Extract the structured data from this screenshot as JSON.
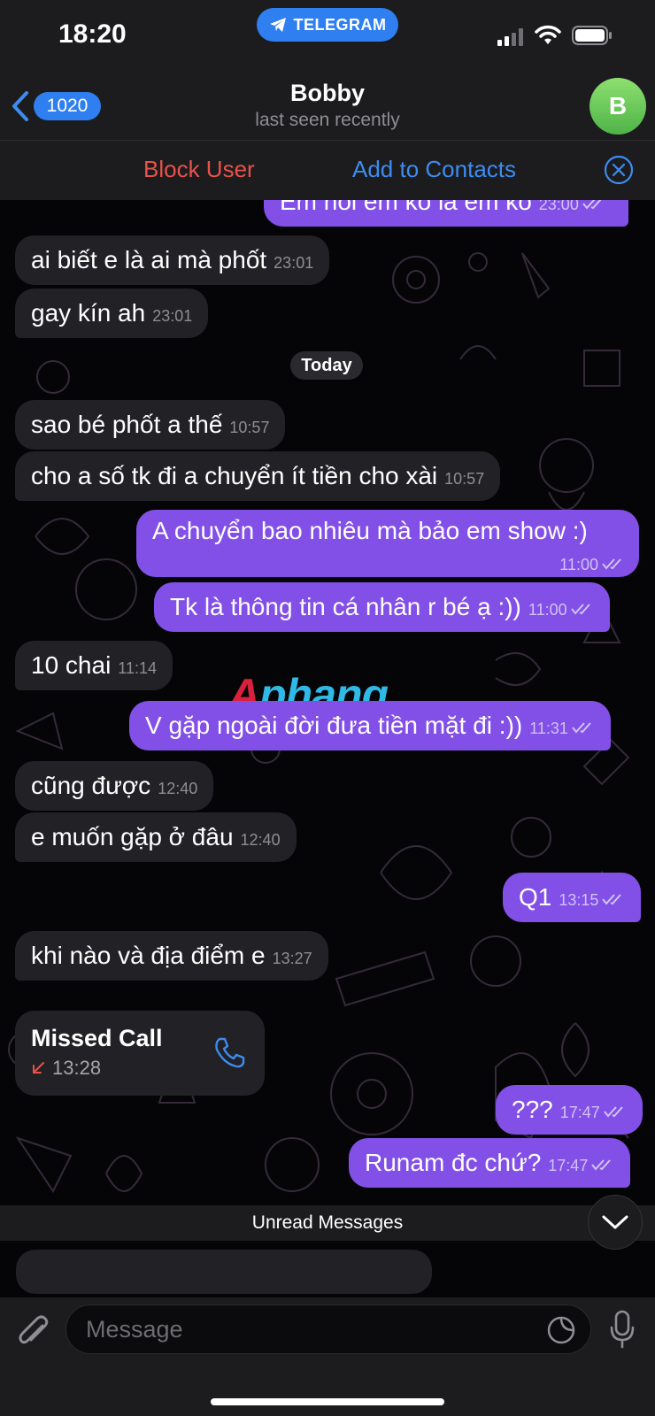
{
  "status_bar": {
    "time": "18:20",
    "app_pill": "TELEGRAM"
  },
  "header": {
    "back_count": "1020",
    "name": "Bobby",
    "status": "last seen recently",
    "avatar_letter": "B"
  },
  "actions": {
    "block": "Block User",
    "add": "Add to Contacts"
  },
  "messages": [
    {
      "dir": "out",
      "text": "Em hỏi em ko là em ko",
      "time": "23:00",
      "read": true
    },
    {
      "dir": "in",
      "text": "ai biết e là ai mà phốt",
      "time": "23:01"
    },
    {
      "dir": "in",
      "text": "gay kín ah",
      "time": "23:01"
    },
    {
      "dir": "in",
      "text": "sao bé phốt a thế",
      "time": "10:57"
    },
    {
      "dir": "in",
      "text": "cho a số tk đi a chuyển ít tiền cho xài",
      "time": "10:57"
    },
    {
      "dir": "out",
      "text": "A chuyển bao nhiêu mà bảo em show :)",
      "time": "11:00",
      "read": true
    },
    {
      "dir": "out",
      "text": "Tk là thông tin cá nhân r bé ạ :))",
      "time": "11:00",
      "read": true
    },
    {
      "dir": "in",
      "text": "10 chai",
      "time": "11:14"
    },
    {
      "dir": "out",
      "text": "V gặp ngoài đời đưa tiền mặt đi :))",
      "time": "11:31",
      "read": true
    },
    {
      "dir": "in",
      "text": "cũng được",
      "time": "12:40"
    },
    {
      "dir": "in",
      "text": "e muốn gặp ở đâu",
      "time": "12:40"
    },
    {
      "dir": "out",
      "text": "Q1",
      "time": "13:15",
      "read": true
    },
    {
      "dir": "in",
      "text": "khi nào và địa điểm e",
      "time": "13:27"
    },
    {
      "dir": "out",
      "text": "???",
      "time": "17:47",
      "read": true
    },
    {
      "dir": "out",
      "text": "Runam đc chứ?",
      "time": "17:47",
      "read": true
    }
  ],
  "date_divider": "Today",
  "missed_call": {
    "title": "Missed Call",
    "time": "13:28"
  },
  "watermark": {
    "part1": "A",
    "part2": "phang"
  },
  "unread_divider": "Unread Messages",
  "composer": {
    "placeholder": "Message"
  },
  "colors": {
    "outgoing": "#8250e6",
    "incoming": "#222126",
    "accent": "#2f7ff0",
    "danger": "#e9524a"
  }
}
